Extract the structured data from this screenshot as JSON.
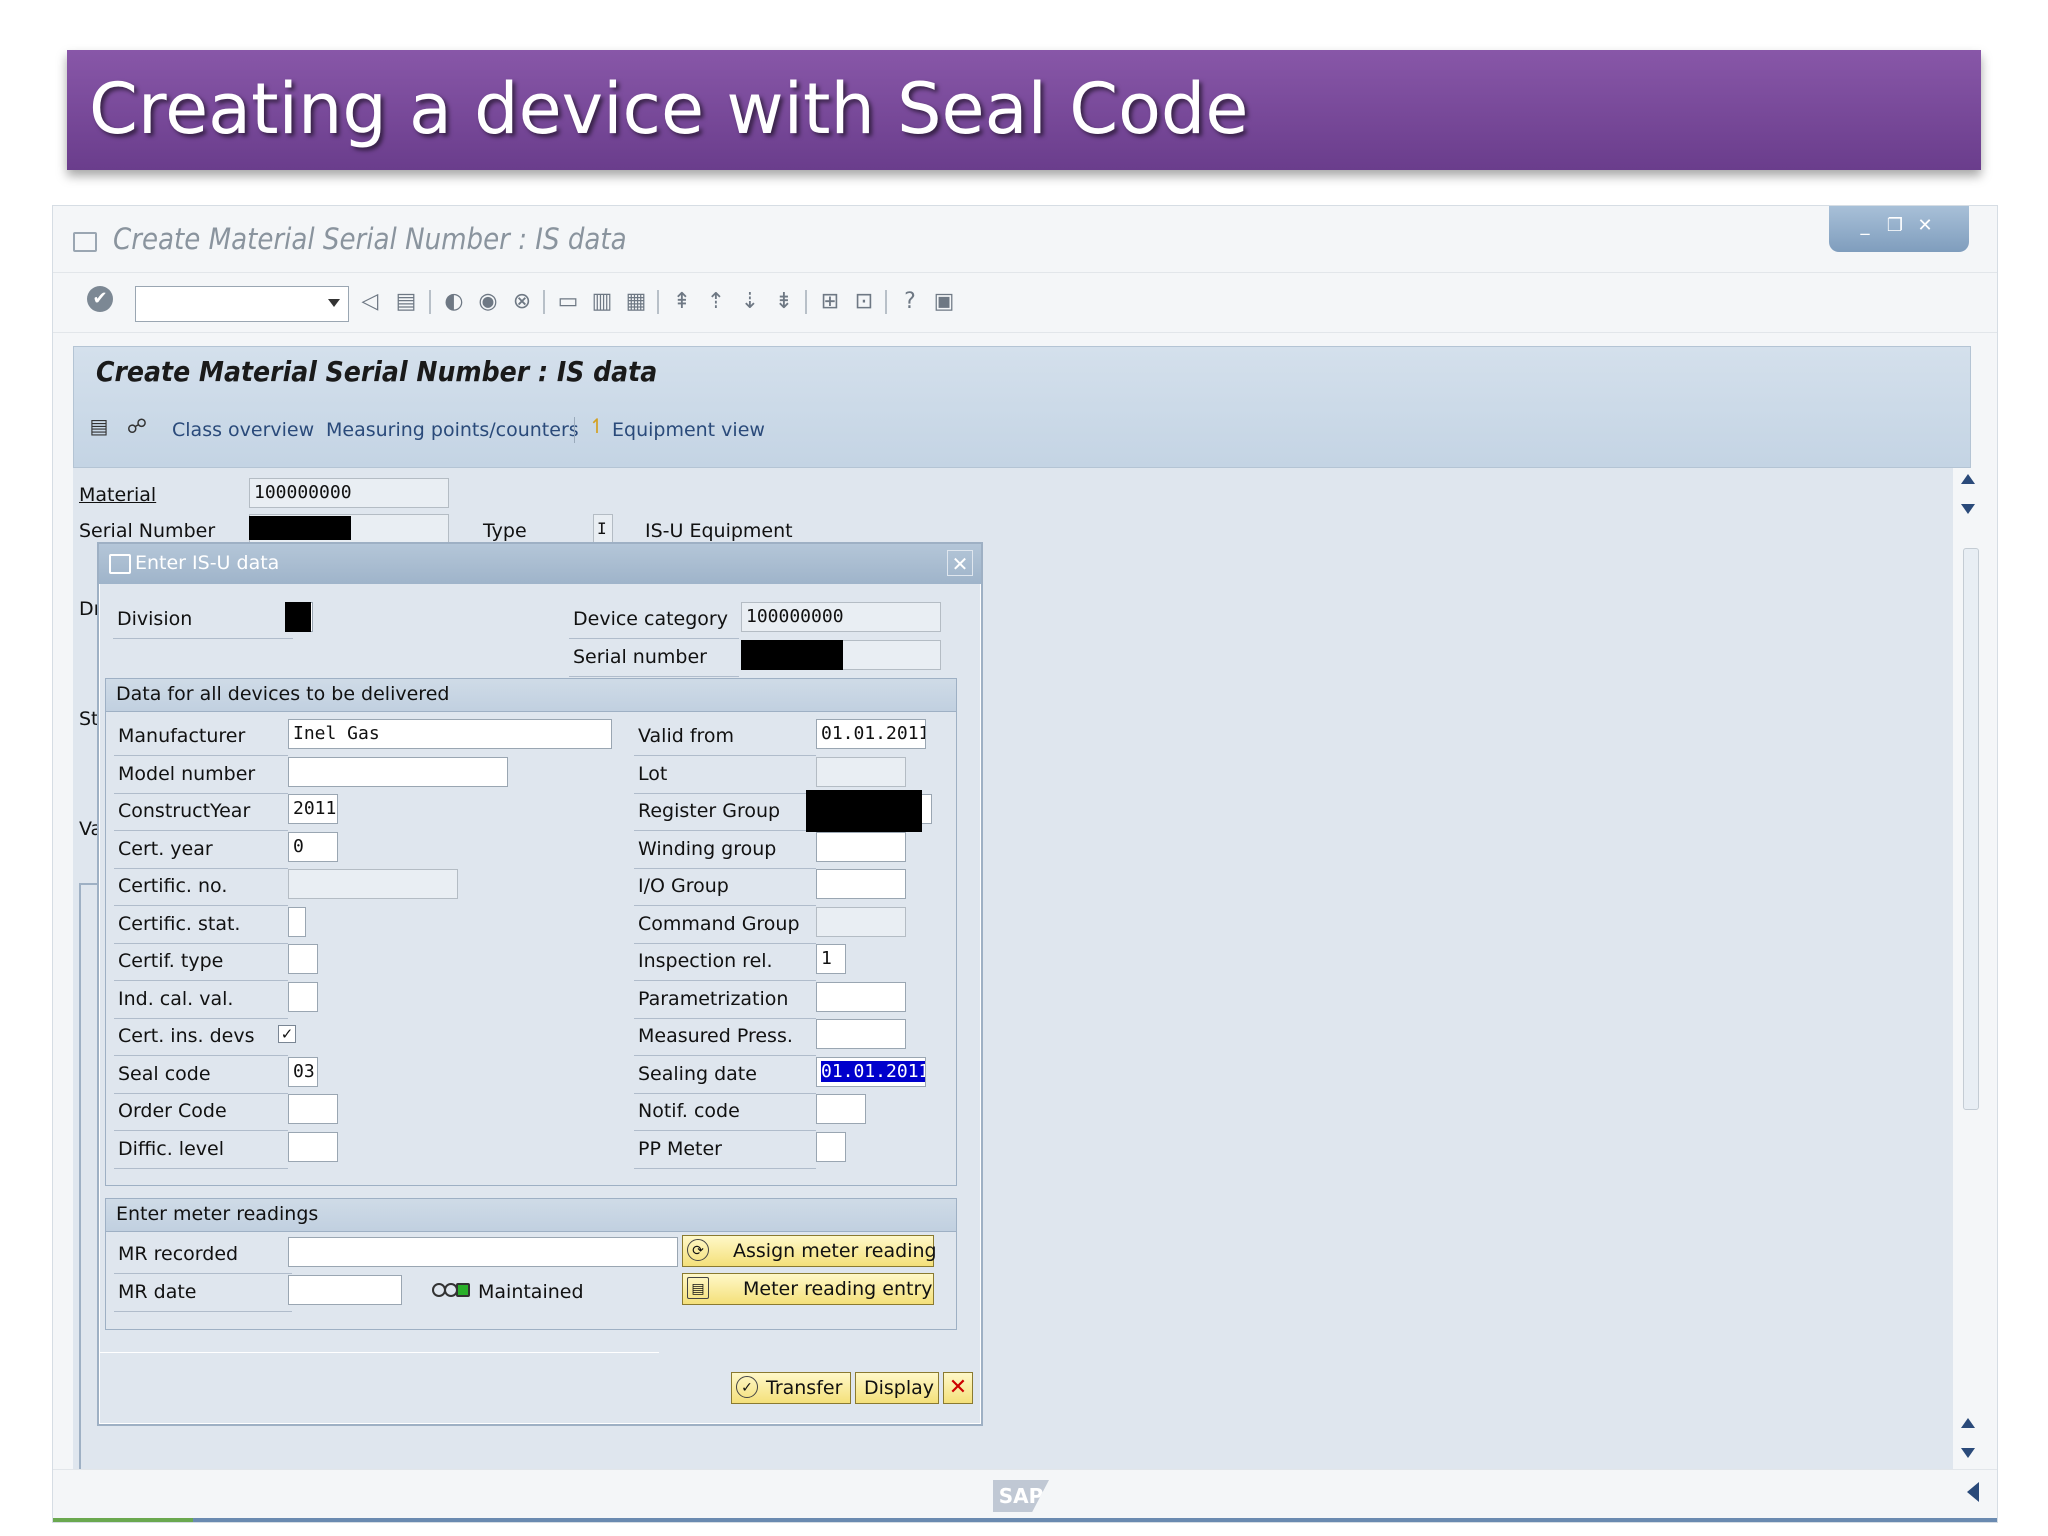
{
  "slide": {
    "title": "Creating a device with Seal Code"
  },
  "window": {
    "title": "Create Material Serial Number : IS data"
  },
  "toolbar": {
    "command_field_value": ""
  },
  "screen": {
    "title": "Create Material Serial Number : IS data",
    "appbar": {
      "class_overview": "Class overview",
      "measuring_points": "Measuring points/counters",
      "equipment_view": "Equipment view"
    },
    "material_label": "Material",
    "material_value": "100000000",
    "serial_number_label": "Serial Number",
    "type_label": "Type",
    "type_value": "I",
    "type_text": "IS-U Equipment",
    "partial_labels": [
      "Dı",
      "St",
      "Va"
    ]
  },
  "dialog": {
    "title": "Enter IS-U data",
    "division_label": "Division",
    "device_category_label": "Device category",
    "device_category_value": "100000000",
    "serial_number_label": "Serial number",
    "group1": {
      "title": "Data for all devices to be delivered",
      "left": [
        {
          "label": "Manufacturer",
          "value": "Inel Gas"
        },
        {
          "label": "Model number",
          "value": ""
        },
        {
          "label": "ConstructYear",
          "value": "2011"
        },
        {
          "label": "Cert. year",
          "value": "0"
        },
        {
          "label": "Certific. no.",
          "value": ""
        },
        {
          "label": "Certific. stat.",
          "value": ""
        },
        {
          "label": "Certif. type",
          "value": ""
        },
        {
          "label": "Ind. cal. val.",
          "value": ""
        },
        {
          "label": "Cert. ins. devs",
          "value": "✓"
        },
        {
          "label": "Seal code",
          "value": "03"
        },
        {
          "label": "Order Code",
          "value": ""
        },
        {
          "label": "Diffic. level",
          "value": ""
        }
      ],
      "right": [
        {
          "label": "Valid from",
          "value": "01.01.2011"
        },
        {
          "label": "Lot",
          "value": ""
        },
        {
          "label": "Register Group",
          "value": ""
        },
        {
          "label": "Winding group",
          "value": ""
        },
        {
          "label": "I/O Group",
          "value": ""
        },
        {
          "label": "Command Group",
          "value": ""
        },
        {
          "label": "Inspection rel.",
          "value": "1"
        },
        {
          "label": "Parametrization",
          "value": ""
        },
        {
          "label": "Measured Press.",
          "value": ""
        },
        {
          "label": "Sealing date",
          "value": "01.01.2011"
        },
        {
          "label": "Notif. code",
          "value": ""
        },
        {
          "label": "PP Meter",
          "value": ""
        }
      ]
    },
    "group2": {
      "title": "Enter meter readings",
      "mr_recorded_label": "MR recorded",
      "mr_date_label": "MR date",
      "maintained_text": "Maintained",
      "assign_button": "Assign meter reading",
      "entry_button": "Meter reading entry"
    },
    "buttons": {
      "transfer": "Transfer",
      "display": "Display"
    }
  },
  "footer": {
    "logo_text": "SAP"
  },
  "icons": [
    "check-icon",
    "back-icon",
    "save-icon",
    "help-icon",
    "close-icon",
    "binoculars-icon",
    "pin-icon"
  ],
  "colors": {
    "slide_title_bar": "#7a4b9c",
    "highlight_field": "#0000cc",
    "button_yellow": "#f4e07a"
  }
}
